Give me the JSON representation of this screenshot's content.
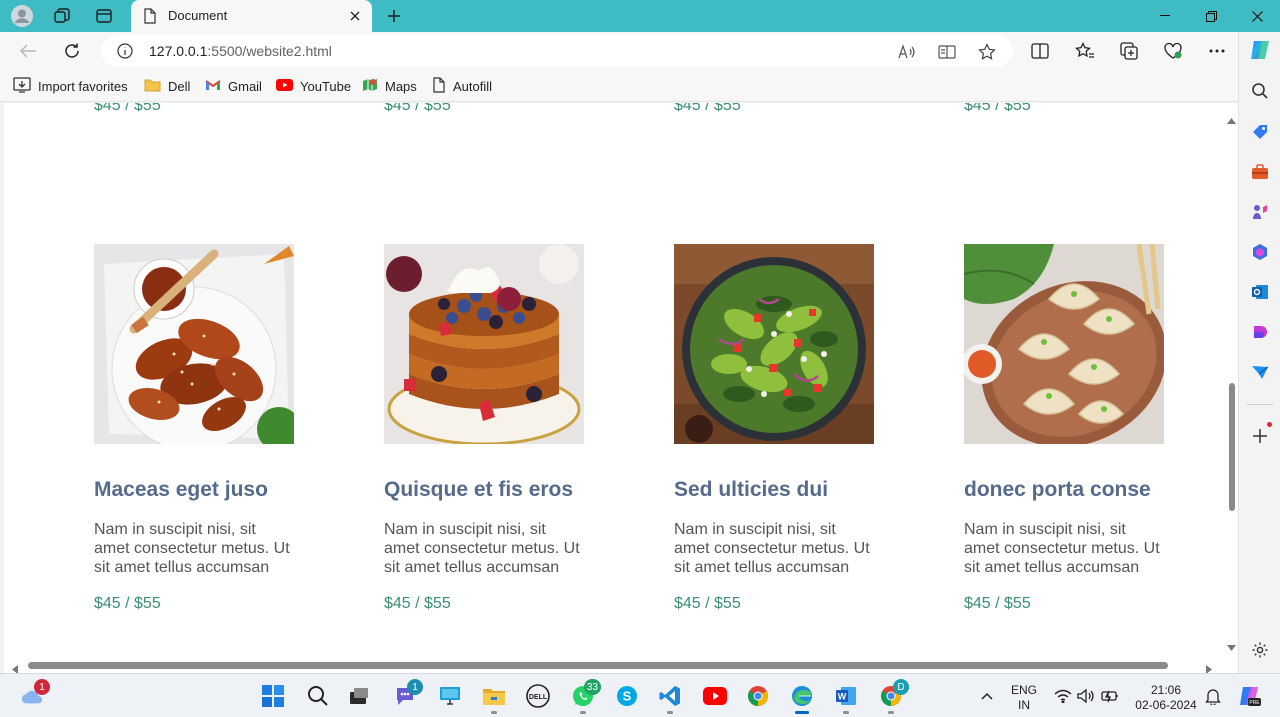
{
  "browser": {
    "tab_title": "Document",
    "url_host": "127.0.0.1",
    "url_path": ":5500/website2.html"
  },
  "favorites": [
    {
      "label": "Import favorites",
      "icon": "import-icon"
    },
    {
      "label": "Dell",
      "icon": "folder-icon"
    },
    {
      "label": "Gmail",
      "icon": "gmail-icon"
    },
    {
      "label": "YouTube",
      "icon": "youtube-icon"
    },
    {
      "label": "Maps",
      "icon": "maps-icon"
    },
    {
      "label": "Autofill",
      "icon": "autofill-icon"
    }
  ],
  "menu": {
    "top_prices": [
      "$45 / $55",
      "$45 / $55",
      "$45 / $55",
      "$45 / $55"
    ],
    "items": [
      {
        "name": "Maceas eget juso",
        "description": "Nam in suscipit nisi, sit amet consectetur metus. Ut sit amet tellus accumsan",
        "price": "$45 / $55",
        "photo": "chicken-wings"
      },
      {
        "name": "Quisque et fis eros",
        "description": "Nam in suscipit nisi, sit amet consectetur metus. Ut sit amet tellus accumsan",
        "price": "$45 / $55",
        "photo": "french-toast"
      },
      {
        "name": "Sed ulticies dui",
        "description": "Nam in suscipit nisi, sit amet consectetur metus. Ut sit amet tellus accumsan",
        "price": "$45 / $55",
        "photo": "salad"
      },
      {
        "name": "donec porta conse",
        "description": "Nam in suscipit nisi, sit amet consectetur metus. Ut sit amet tellus accumsan",
        "price": "$45 / $55",
        "photo": "dumplings"
      }
    ]
  },
  "taskbar": {
    "weather_badge": "1",
    "teams_badge": "1",
    "whatsapp_badge": "33",
    "chrome_badge": "D",
    "lang_line1": "ENG",
    "lang_line2": "IN",
    "time": "21:06",
    "date": "02-06-2024"
  },
  "colors": {
    "tabstrip": "#3ebbc3",
    "item_title": "#566a8c",
    "price": "#3a8f73"
  }
}
